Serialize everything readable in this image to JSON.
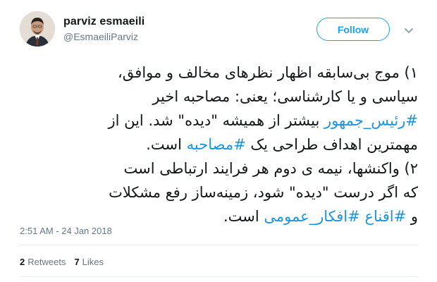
{
  "user": {
    "display_name": "parviz esmaeili",
    "handle": "@EsmaeiliParviz",
    "follow_label": "Follow"
  },
  "tweet": {
    "line1": "۱) موج بی‌سابقه اظهار نظرهای مخالف و موافق،",
    "line2": "سیاسی و یا کارشناسی؛ یعنی: مصاحبه اخیر",
    "line3_tag": "#رئیس_جمهور",
    "line3_rest": " بیشتر از همیشه \"دیده\" شد. این از",
    "line4_pre": "مهمترین اهداف طراحی یک ",
    "line4_tag": "#مصاحبه",
    "line4_post": " است.",
    "line5": "۲) واکنشها، نیمه ی دوم هر فرایند ارتباطی است",
    "line6": "که اگر درست \"دیده\" شود، زمینه‌ساز رفع مشکلات",
    "line7_pre": "و ",
    "line7_tag1": "#اقناع",
    "line7_space": " ",
    "line7_tag2": "#افکار_عمومی",
    "line7_post": " است."
  },
  "timestamp": "2:51 AM - 24 Jan 2018",
  "stats": {
    "retweets_count": "2",
    "retweets_label": "Retweets",
    "likes_count": "7",
    "likes_label": "Likes"
  },
  "colors": {
    "accent": "#1da1f2",
    "hashtag": "#1b95e0",
    "muted": "#657786"
  },
  "icons": {
    "caret": "chevron-down-icon"
  }
}
